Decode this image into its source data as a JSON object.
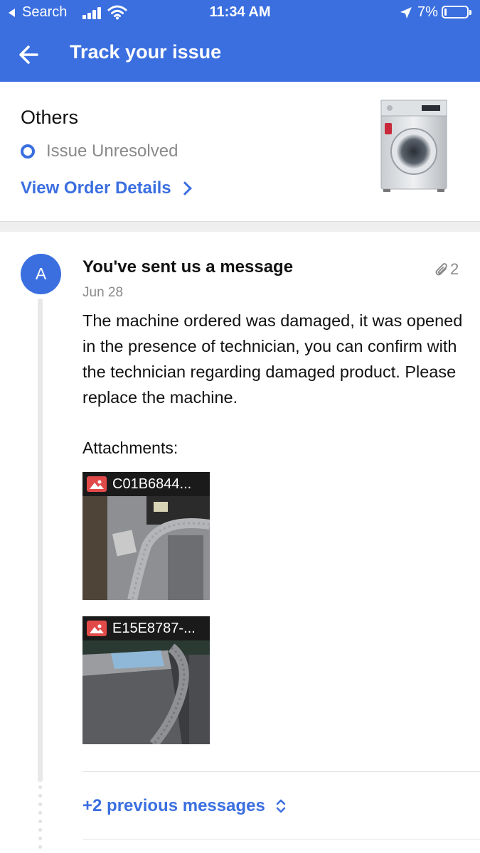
{
  "status_bar": {
    "back_label": "Search",
    "time": "11:34 AM",
    "battery_percent": "7%",
    "battery_level": 0.07
  },
  "header": {
    "title": "Track your issue"
  },
  "order": {
    "category": "Others",
    "status": "Issue Unresolved",
    "view_details_label": "View Order Details",
    "product_image": "front-load washing machine"
  },
  "message": {
    "avatar_letter": "A",
    "title": "You've sent us a message",
    "attachment_count": "2",
    "date": "Jun 28",
    "body": "The machine ordered was damaged, it was opened in the presence of technician, you can confirm with the technician regarding damaged product. Please replace the machine.",
    "attachments_label": "Attachments:",
    "attachments": [
      {
        "name": "C01B6844...",
        "icon": "image-icon"
      },
      {
        "name": "E15E8787-...",
        "icon": "image-icon"
      }
    ]
  },
  "previous_messages_label": "+2 previous messages",
  "colors": {
    "accent": "#3b6fe0",
    "muted": "#8a8a8a",
    "attachment_icon": "#e24a4a"
  }
}
